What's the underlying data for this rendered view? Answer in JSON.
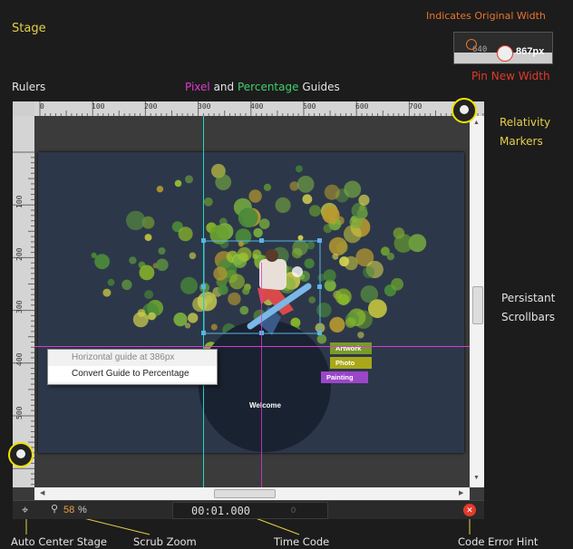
{
  "annotations": {
    "stage": "Stage",
    "rulers": "Rulers",
    "guides_pixel": "Pixel",
    "guides_and": " and ",
    "guides_percentage": "Percentage",
    "guides_suffix": " Guides",
    "indicates_original_width": "Indicates Original Width",
    "pin_new_width": "Pin New Width",
    "relativity_markers_1": "Relativity",
    "relativity_markers_2": "Markers",
    "persistant_scrollbars_1": "Persistant",
    "persistant_scrollbars_2": "Scrollbars",
    "auto_center_stage": "Auto Center Stage",
    "scrub_zoom": "Scrub Zoom",
    "time_code": "Time Code",
    "code_error_hint": "Code Error Hint"
  },
  "width_inset": {
    "original_value": "640",
    "new_value": "867px"
  },
  "ruler": {
    "top_labels": [
      "0",
      "100",
      "200",
      "300",
      "400",
      "500",
      "600",
      "700"
    ],
    "left_labels": [
      "100",
      "200",
      "300",
      "400",
      "500"
    ]
  },
  "context_menu": {
    "item_disabled": "Horizontal guide at 386px",
    "item_action": "Convert Guide to Percentage"
  },
  "stage_content": {
    "tags": [
      "Artwork",
      "Photo",
      "Painting"
    ],
    "welcome": "Welcome",
    "tag_colors": [
      "#7a9a2a",
      "#a8a81a",
      "#9a46c8"
    ]
  },
  "status": {
    "zoom_value": "58",
    "zoom_unit": "%",
    "timecode": "00:01.000",
    "frame_value": "0"
  },
  "colors": {
    "accent_yellow": "#e6cf4a",
    "guide_pixel": "#d93ad0",
    "guide_percentage": "#2ad0c8",
    "error": "#e23a2a",
    "zoom_value": "#e8a040"
  }
}
